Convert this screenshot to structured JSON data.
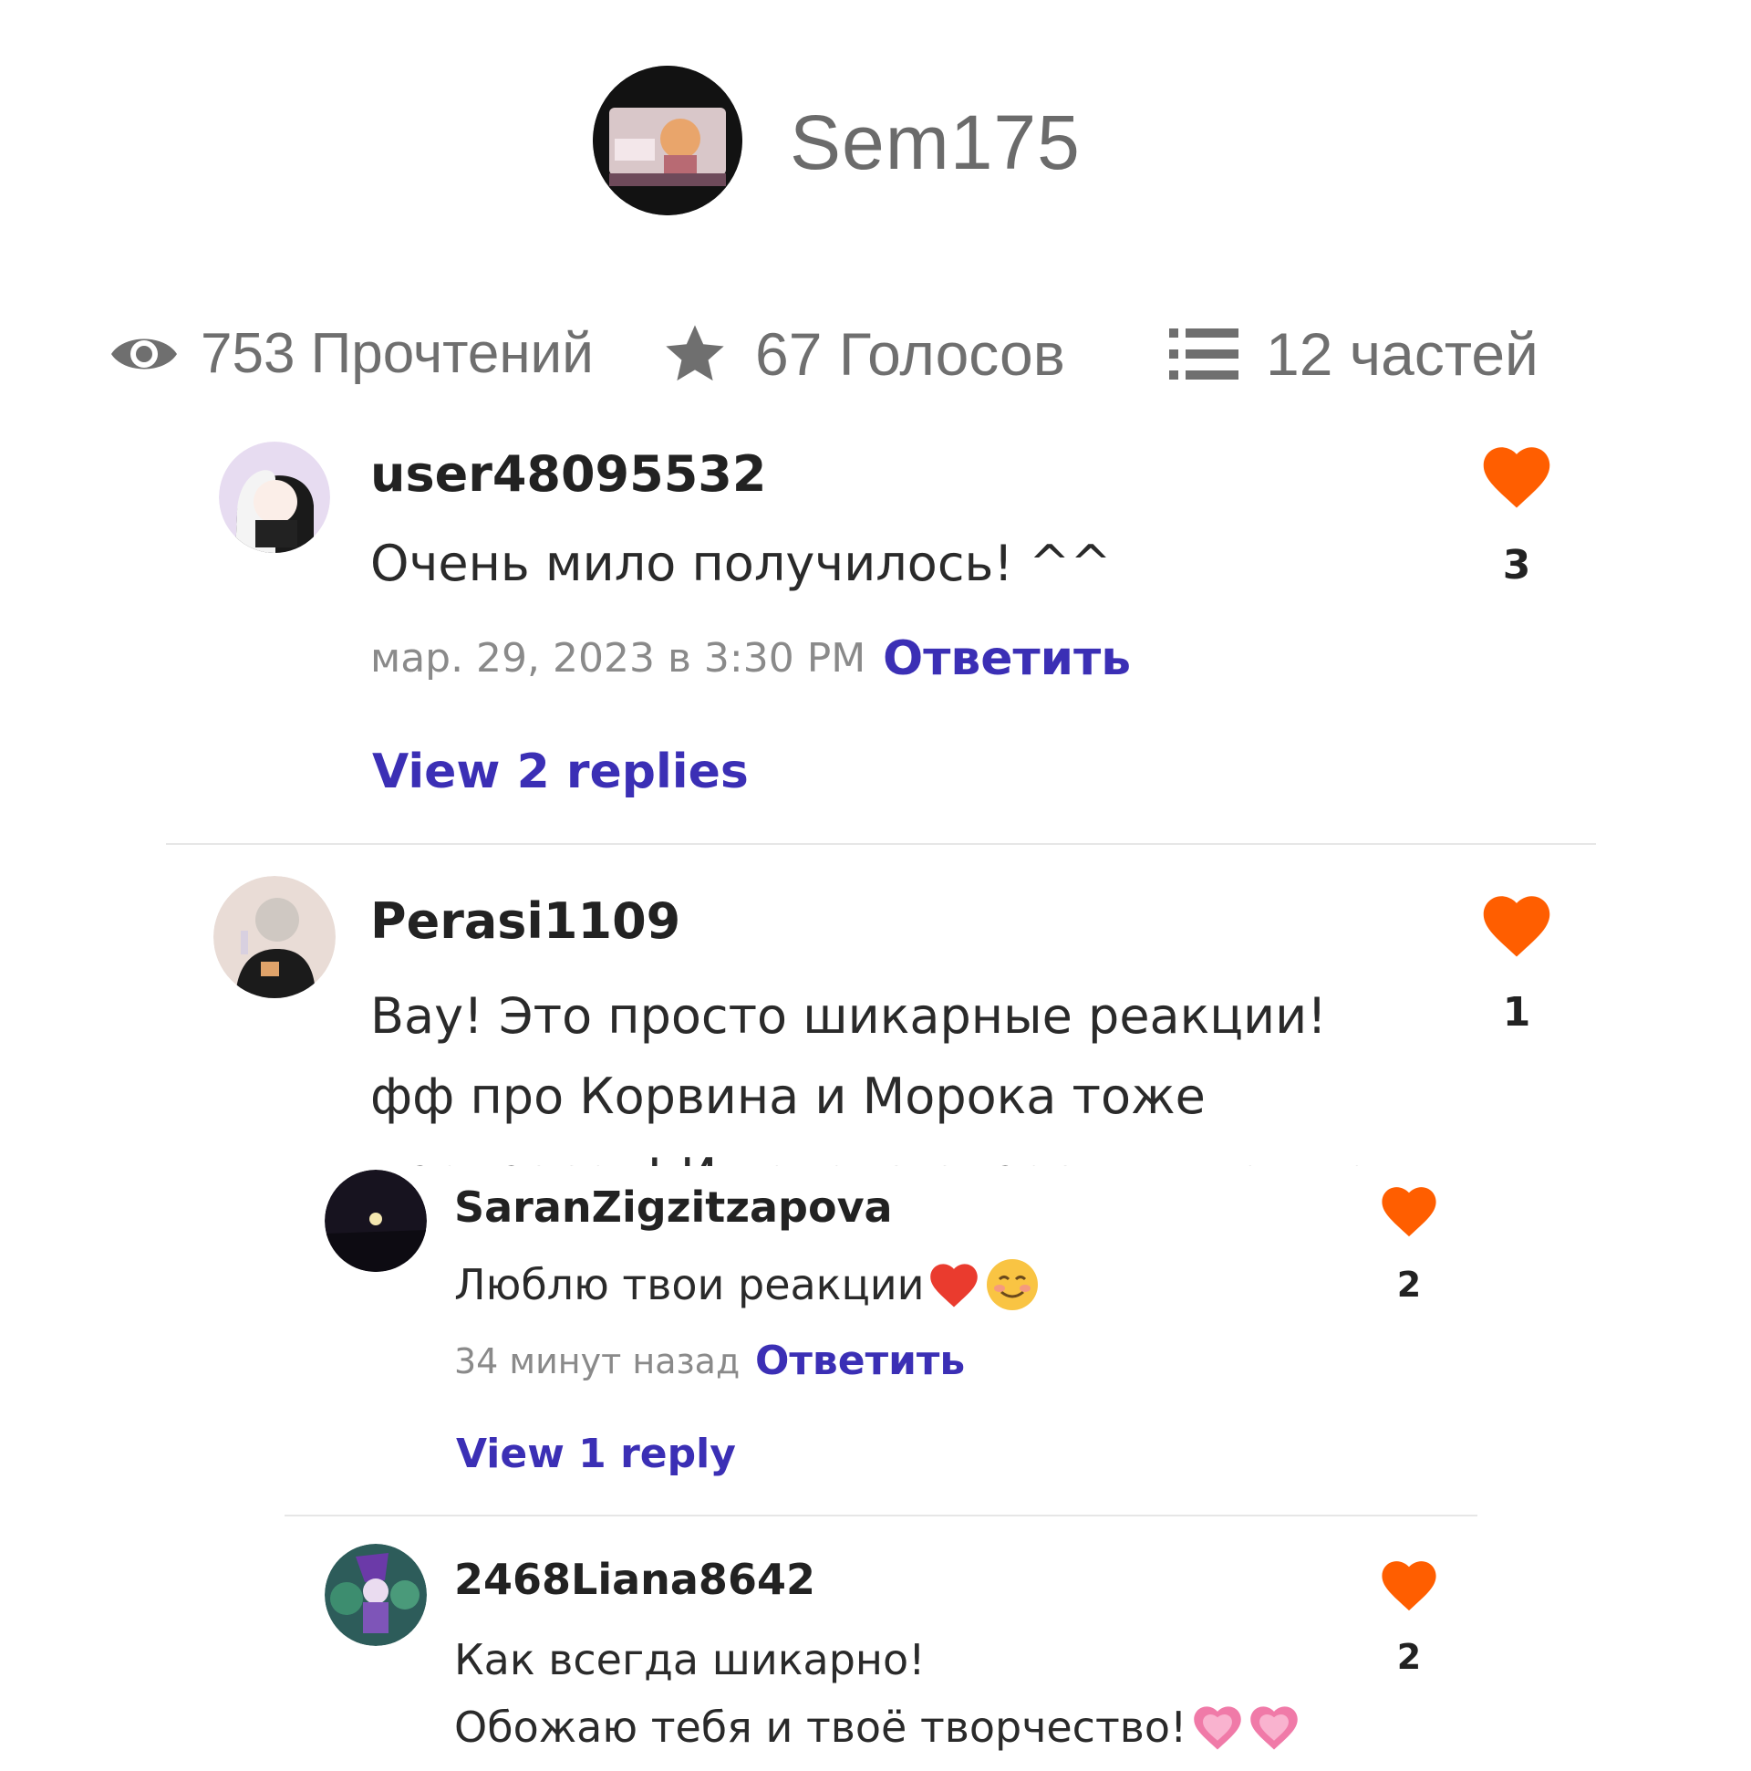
{
  "author": {
    "name": "Sem175"
  },
  "stats": {
    "reads": "753 Прочтений",
    "votes": "67 Голосов",
    "parts": "12 частей"
  },
  "colors": {
    "accent": "#3b2fb5",
    "heart": "#ff5e00"
  },
  "comments": [
    {
      "username": "user48095532",
      "text": "Очень мило получилось! ^^",
      "timestamp": "мар. 29, 2023 в 3:30 PM",
      "reply_label": "Ответить",
      "likes": "3",
      "view_replies": "View 2 replies"
    },
    {
      "username": "Perasi1109",
      "text_lines": [
        "Вау! Это просто шикарные реакции!",
        "фф про Корвина и Морока тоже",
        "прекрасен! И хотела спросить: можно"
      ],
      "likes": "1"
    }
  ],
  "replies": [
    {
      "username": "SaranZigzitzapova",
      "text": "Люблю твои реакции",
      "timestamp": "34 минут назад",
      "reply_label": "Ответить",
      "likes": "2",
      "view_replies": "View 1 reply"
    },
    {
      "username": "2468Liana8642",
      "text_lines": [
        "Как всегда шикарно!",
        "Обожаю тебя и твоё творчество!"
      ],
      "likes": "2"
    }
  ]
}
